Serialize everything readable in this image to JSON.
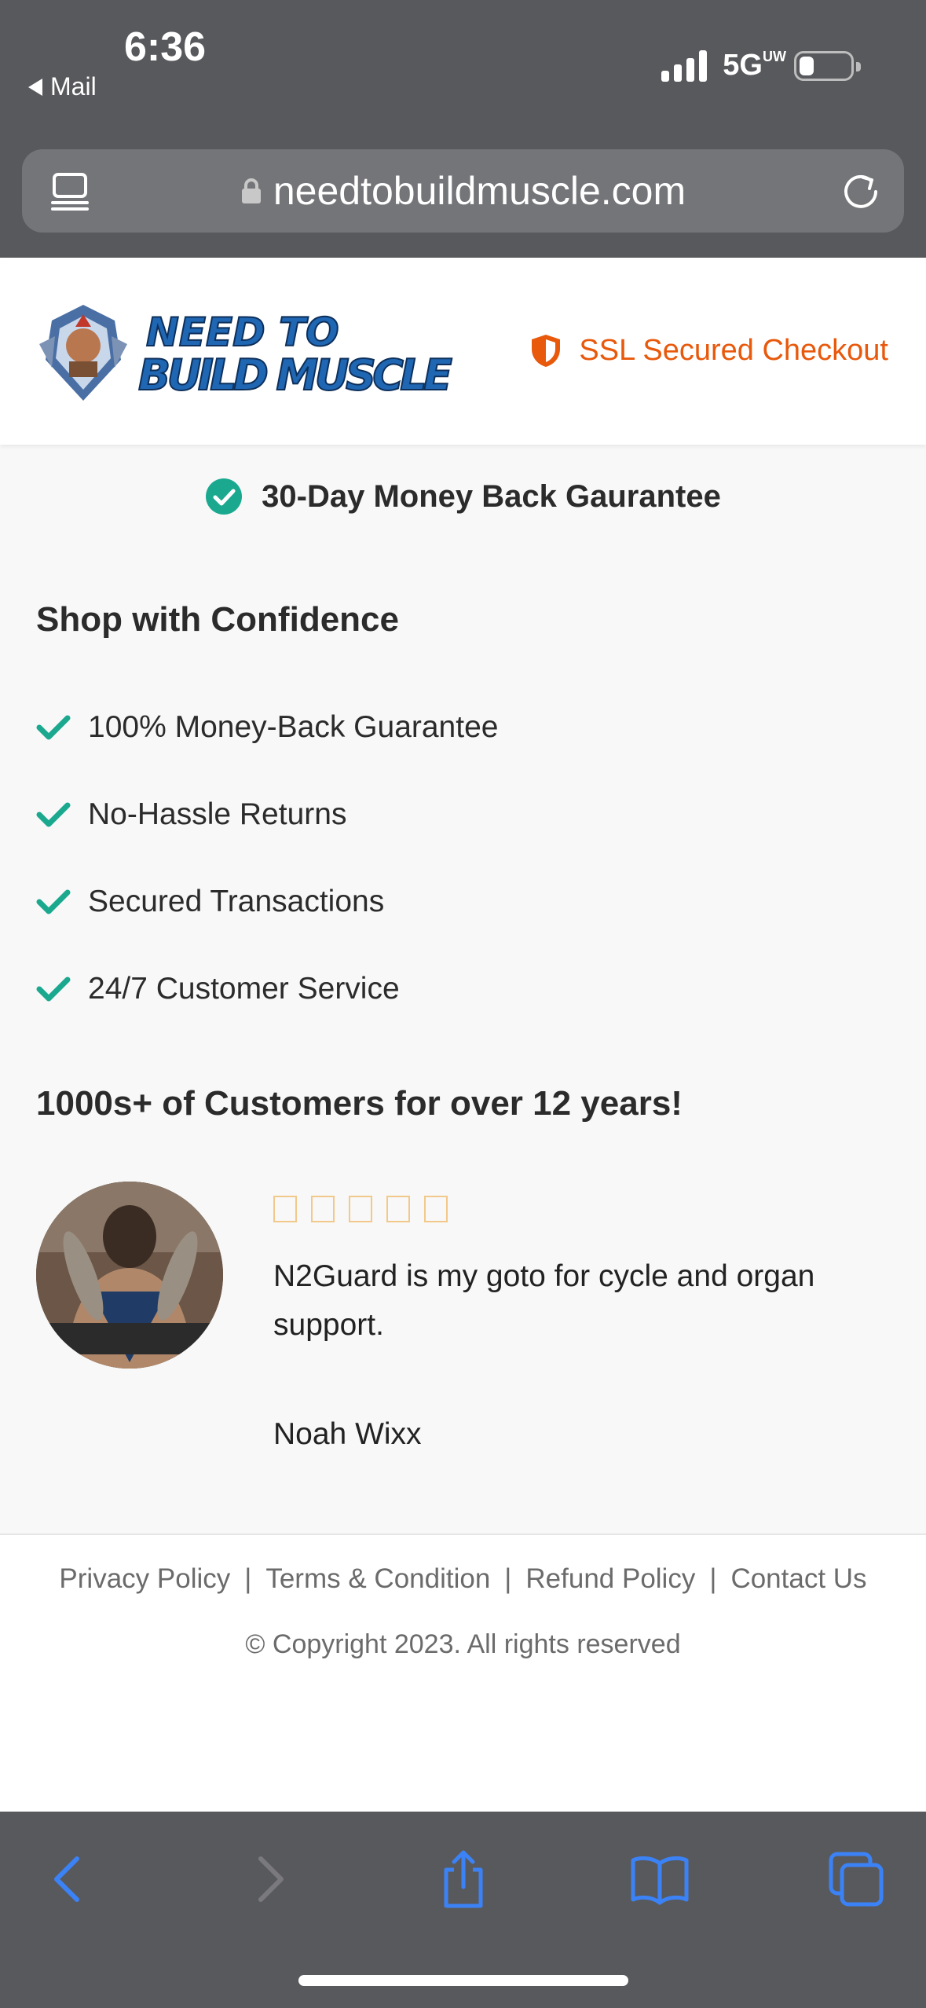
{
  "status_bar": {
    "time": "6:36",
    "back_app": "Mail",
    "network": "5G",
    "network_sub": "UW"
  },
  "browser": {
    "url": "needtobuildmuscle.com",
    "toolbar": {
      "back": "chevron-left-icon",
      "forward": "chevron-right-icon",
      "share": "share-icon",
      "bookmarks": "book-icon",
      "tabs": "tabs-icon"
    },
    "accent_color": "#3b82f6"
  },
  "header": {
    "logo_text_line1": "NEED TO",
    "logo_text_line2": "BUILD MUSCLE",
    "ssl_label": "SSL Secured Checkout",
    "ssl_color": "#e8590c"
  },
  "guarantee": {
    "label": "30-Day Money Back Gaurantee"
  },
  "confidence": {
    "heading": "Shop with Confidence",
    "items": [
      "100% Money-Back Guarantee",
      "No-Hassle Returns",
      "Secured Transactions",
      "24/7 Customer Service"
    ],
    "check_color": "#1aa98f"
  },
  "testimonials": {
    "heading": "1000s+ of Customers for over 12 years!",
    "review": {
      "rating": 5,
      "text": "N2Guard is my goto for cycle and organ support.",
      "author": "Noah Wixx"
    }
  },
  "footer": {
    "links": [
      "Privacy Policy",
      "Terms & Condition",
      "Refund Policy",
      "Contact Us"
    ],
    "separator": "|",
    "copyright": "© Copyright 2023. All rights reserved"
  }
}
